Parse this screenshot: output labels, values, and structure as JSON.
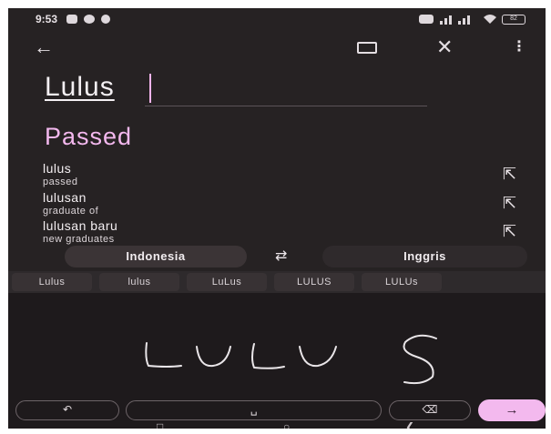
{
  "status_bar": {
    "time": "9:53",
    "battery": "82"
  },
  "toolbar": {
    "back_icon": "arrow-left-icon",
    "keyboard_icon": "keyboard-icon",
    "close_icon": "close-icon",
    "more_icon": "more-vert-icon"
  },
  "input": {
    "text": "Lulus"
  },
  "translation": {
    "text": "Passed"
  },
  "suggestions": [
    {
      "word": "lulus",
      "translation": "passed"
    },
    {
      "word": "lulusan",
      "translation": "graduate of"
    },
    {
      "word": "lulusan baru",
      "translation": "new graduates"
    }
  ],
  "languages": {
    "source": "Indonesia",
    "target": "Inggris"
  },
  "handwriting": {
    "candidates": [
      "Lulus",
      "lulus",
      "LuLus",
      "LULUS",
      "LULUs"
    ]
  },
  "colors": {
    "accent": "#f3b9ee",
    "background": "#262223"
  }
}
